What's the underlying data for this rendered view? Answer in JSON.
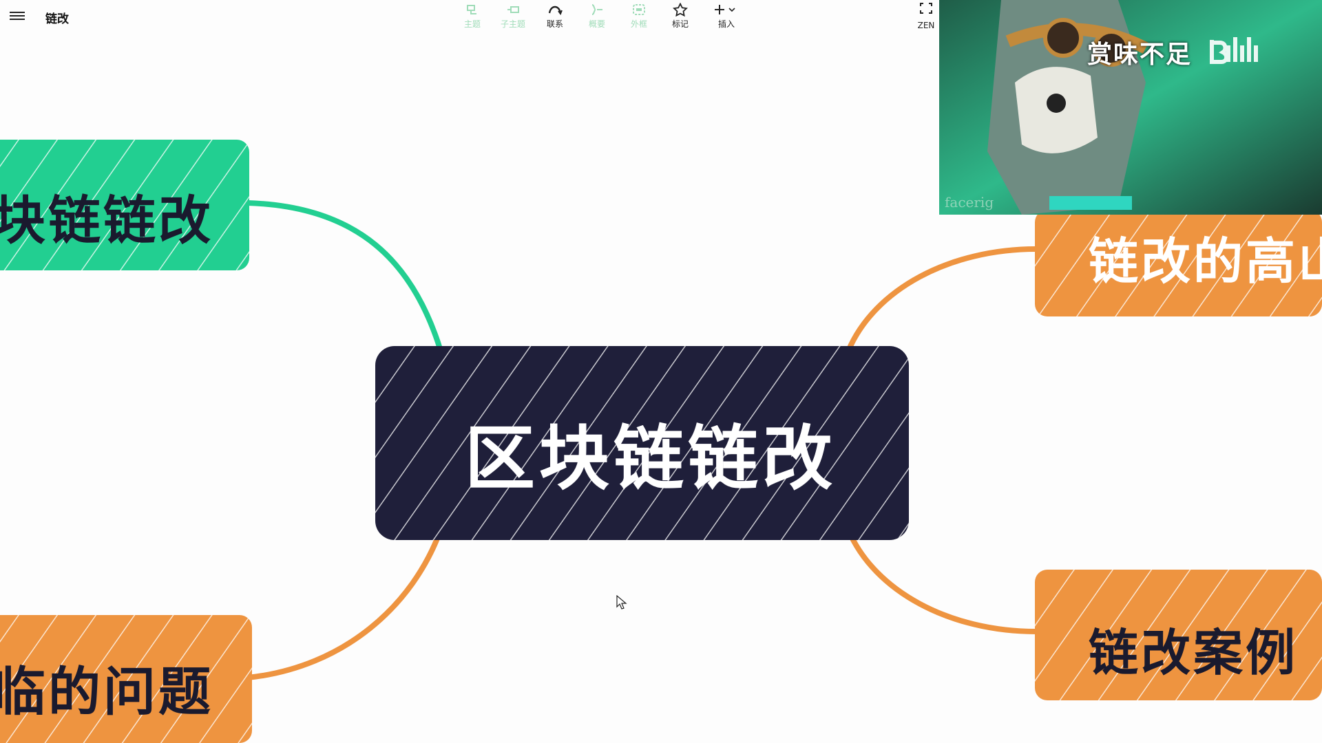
{
  "app": {
    "doc_title": "链改"
  },
  "toolbar": {
    "items": [
      {
        "label": "主题",
        "icon": "topic-icon",
        "enabled": false
      },
      {
        "label": "子主题",
        "icon": "subtopic-icon",
        "enabled": false
      },
      {
        "label": "联系",
        "icon": "relationship-icon",
        "enabled": true
      },
      {
        "label": "概要",
        "icon": "summary-icon",
        "enabled": false
      },
      {
        "label": "外框",
        "icon": "boundary-icon",
        "enabled": false
      },
      {
        "label": "标记",
        "icon": "star-icon",
        "enabled": true
      },
      {
        "label": "插入",
        "icon": "plus-icon",
        "enabled": true
      }
    ],
    "zen_label": "ZEN"
  },
  "mindmap": {
    "root": {
      "text": "区块链链改",
      "color": "#1f1f3a"
    },
    "branches": [
      {
        "id": "left-top",
        "text": "块链链改",
        "color": "#22cf91"
      },
      {
        "id": "left-bottom",
        "text": "临的问题",
        "color": "#ee9440"
      },
      {
        "id": "right-top",
        "text": "链改的高山",
        "color": "#ee9440"
      },
      {
        "id": "right-bottom",
        "text": "链改案例",
        "color": "#ee9440"
      }
    ]
  },
  "video_overlay": {
    "caption": "赏味不足",
    "watermark": "facerig",
    "brand_icon": "bilibili-logo-icon"
  }
}
